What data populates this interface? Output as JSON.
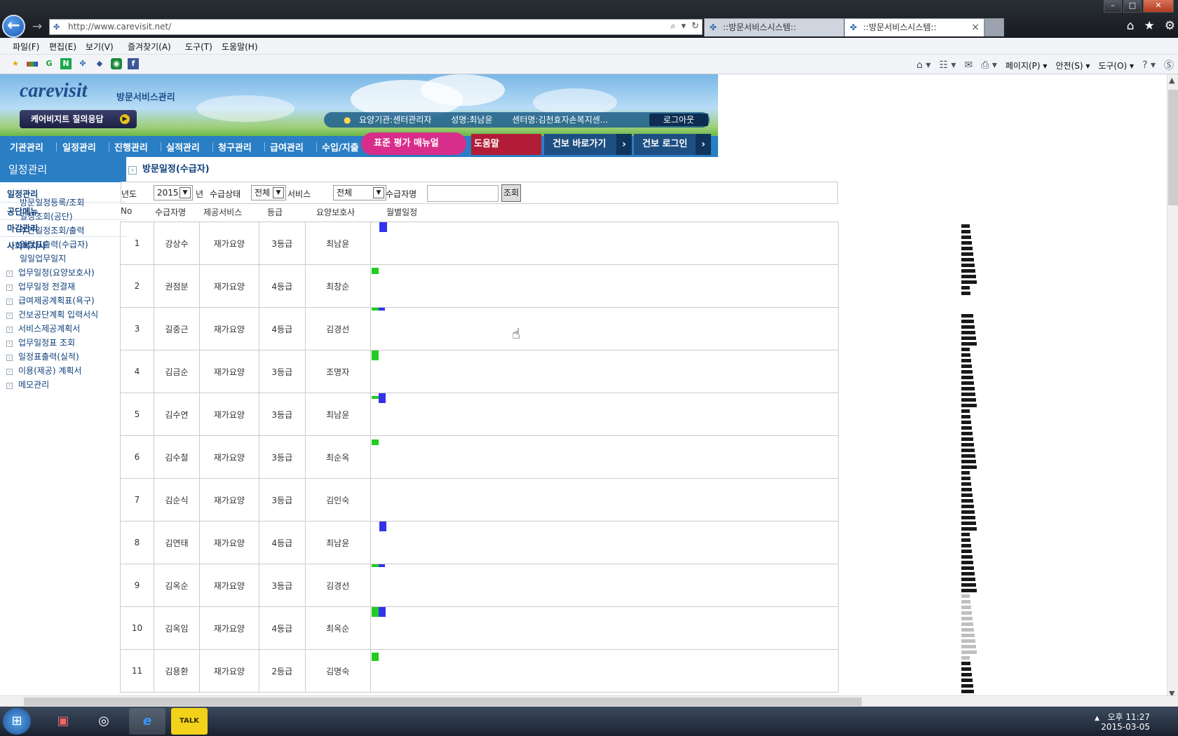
{
  "browser": {
    "window_controls": {
      "minimize": "–",
      "maximize": "□",
      "close": "✕"
    },
    "back": "←",
    "forward": "→",
    "address": "http://www.carevisit.net/",
    "tabs": [
      {
        "label": "::방문서비스시스템::",
        "active": false
      },
      {
        "label": "::방문서비스시스템::",
        "active": true
      }
    ],
    "menu": [
      "파일(F)",
      "편집(E)",
      "보기(V)",
      "즐겨찾기(A)",
      "도구(T)",
      "도움말(H)"
    ],
    "command_bar": [
      "페이지(P) ▾",
      "안전(S) ▾",
      "도구(O) ▾"
    ]
  },
  "site": {
    "logo": "carevisit",
    "logo_sub": "방문서비스관리",
    "qa_button": "케어비지트 질의응답",
    "user": {
      "org": "요양기관:센터관리자",
      "name": "성명:최남윤",
      "center": "센터명:김천효자손복지센..."
    },
    "logout": "로그아웃",
    "nav": [
      "기관관리",
      "일정관리",
      "진행관리",
      "실적관리",
      "청구관리",
      "급여관리",
      "수입/지출"
    ],
    "overlay_pink": "표준 평가 매뉴얼",
    "overlay_red": "도움말",
    "kb_link": "건보 바로가기",
    "kb_login": "건보 로그인"
  },
  "sidebar": {
    "title": "일정관리",
    "sections": [
      "일정관리",
      "공단메뉴",
      "마감관리",
      "사회복지사"
    ],
    "subitems": [
      "방문일정등록/조회",
      "일정조회(공단)",
      "주간일정조회/출력",
      "일정표출력(수급자)",
      "일일업무일지"
    ],
    "items": [
      "업무일정(요양보호사)",
      "업무일정 전결재",
      "급여제공계획표(욕구)",
      "건보공단계획 입력서식",
      "서비스제공계획서",
      "업무일정표 조회",
      "일정표출력(실적)",
      "이용(제공) 계획서",
      "메모관리"
    ]
  },
  "content": {
    "heading": "방문일정(수급자)",
    "search": {
      "year_label": "년도",
      "year_value": "2015",
      "year_suffix": "년",
      "status_label": "수급상태",
      "status_value": "전체",
      "service_label": "서비스",
      "service_value": "전체",
      "name_label": "수급자명",
      "name_value": "",
      "button": "조회"
    },
    "columns": [
      "No",
      "수급자명",
      "제공서비스",
      "등급",
      "요양보호사",
      "월별일정"
    ],
    "rows": [
      {
        "no": "1",
        "name": "강상수",
        "service": "재가요양",
        "grade": "3등급",
        "caregiver": "최남윤"
      },
      {
        "no": "2",
        "name": "권점분",
        "service": "재가요양",
        "grade": "4등급",
        "caregiver": "최창순"
      },
      {
        "no": "3",
        "name": "길중근",
        "service": "재가요양",
        "grade": "4등급",
        "caregiver": "김경선"
      },
      {
        "no": "4",
        "name": "김금순",
        "service": "재가요양",
        "grade": "3등급",
        "caregiver": "조명자"
      },
      {
        "no": "5",
        "name": "김수연",
        "service": "재가요양",
        "grade": "3등급",
        "caregiver": "최남윤"
      },
      {
        "no": "6",
        "name": "김수철",
        "service": "재가요양",
        "grade": "3등급",
        "caregiver": "최순옥"
      },
      {
        "no": "7",
        "name": "김순식",
        "service": "재가요양",
        "grade": "3등급",
        "caregiver": "김인숙"
      },
      {
        "no": "8",
        "name": "김연태",
        "service": "재가요양",
        "grade": "4등급",
        "caregiver": "최남윤"
      },
      {
        "no": "9",
        "name": "김옥순",
        "service": "재가요양",
        "grade": "3등급",
        "caregiver": "김경선"
      },
      {
        "no": "10",
        "name": "김옥임",
        "service": "재가요양",
        "grade": "4등급",
        "caregiver": "최옥순"
      },
      {
        "no": "11",
        "name": "김용환",
        "service": "재가요양",
        "grade": "2등급",
        "caregiver": "김명숙"
      }
    ]
  },
  "taskbar": {
    "talk": "TALK",
    "time": "오후 11:27",
    "date": "2015-03-05"
  },
  "colors": {
    "nav_blue": "#2a7ec4",
    "schedule_green": "#22cc22",
    "schedule_blue": "#3333ee",
    "overlay_pink": "#d82d8b",
    "overlay_red": "#b21c36"
  }
}
